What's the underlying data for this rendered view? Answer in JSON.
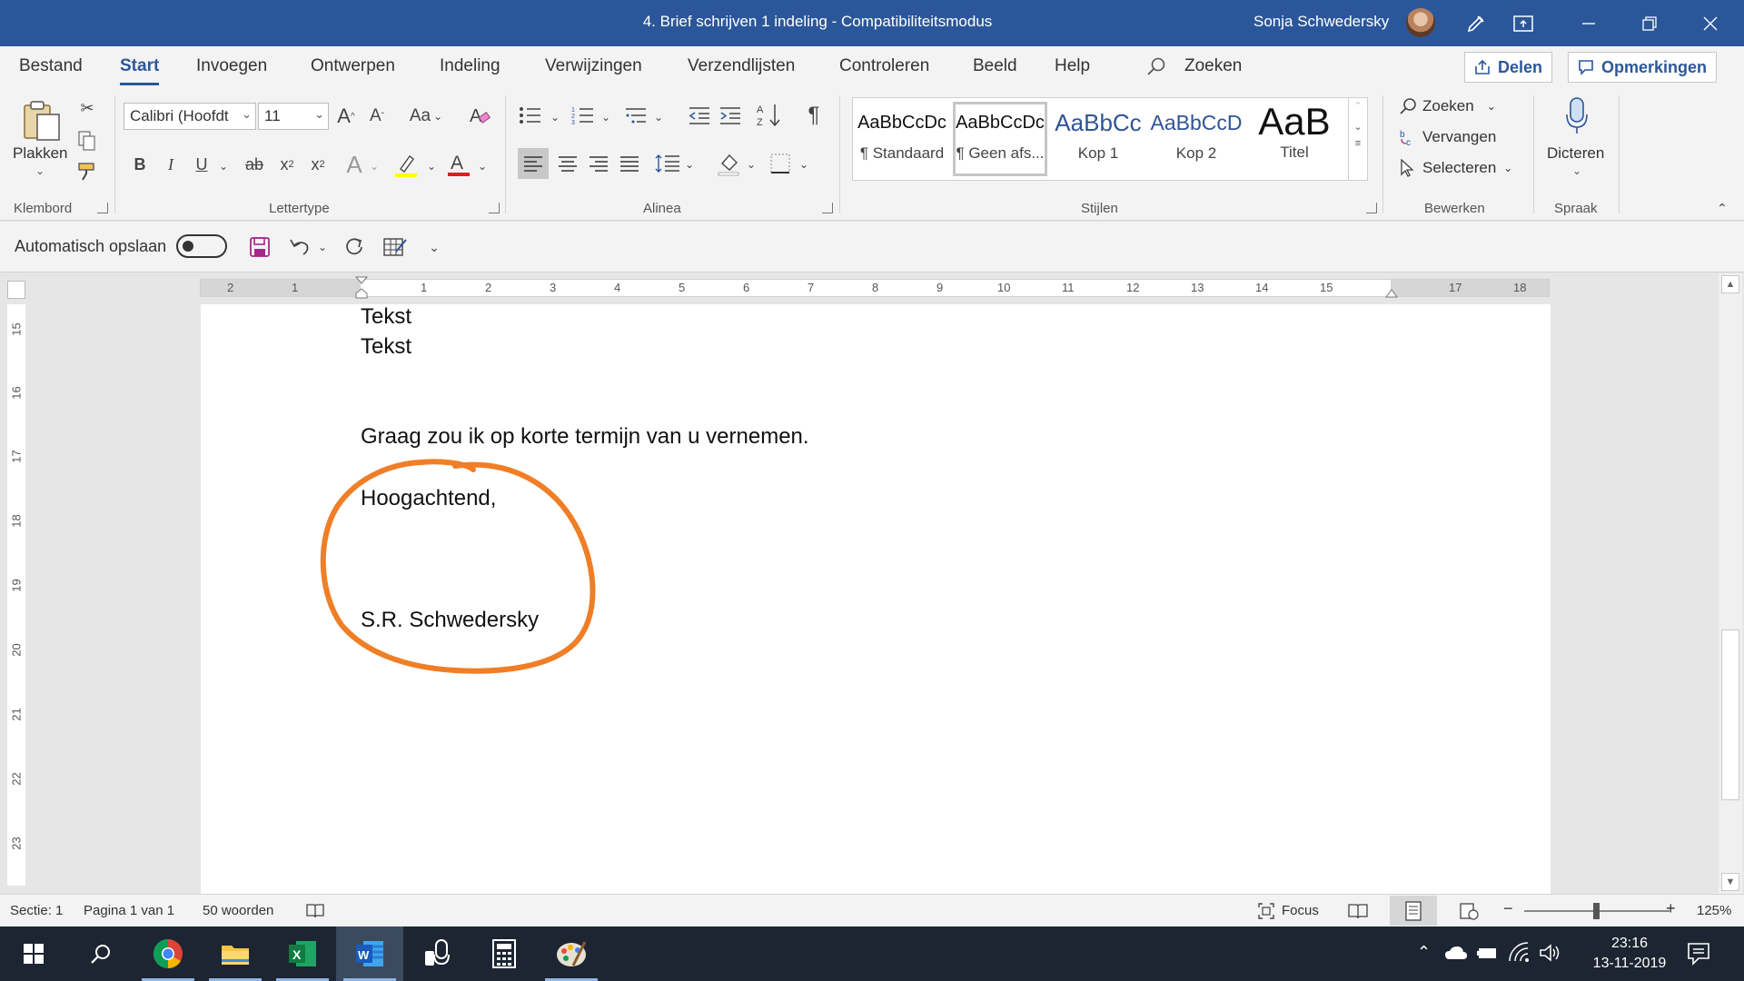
{
  "titlebar": {
    "document_title": "4. Brief schrijven 1 indeling  -  Compatibiliteitsmodus",
    "user_name": "Sonja Schwedersky",
    "icons": [
      "pen-icon",
      "ribbon-display-icon",
      "minimize-icon",
      "restore-icon",
      "close-icon"
    ]
  },
  "tabs": [
    "Bestand",
    "Start",
    "Invoegen",
    "Ontwerpen",
    "Indeling",
    "Verwijzingen",
    "Verzendlijsten",
    "Controleren",
    "Beeld",
    "Help"
  ],
  "active_tab": "Start",
  "search_label": "Zoeken",
  "share": {
    "delen": "Delen",
    "opmerkingen": "Opmerkingen"
  },
  "ribbon": {
    "clipboard": {
      "label": "Klembord",
      "paste": "Plakken"
    },
    "font": {
      "label": "Lettertype",
      "font_name": "Calibri (Hoofdt",
      "font_size": "11",
      "case_btn": "Aa"
    },
    "paragraph": {
      "label": "Alinea"
    },
    "styles": {
      "label": "Stijlen",
      "items": [
        {
          "sample": "AaBbCcDc",
          "name": "¶ Standaard"
        },
        {
          "sample": "AaBbCcDc",
          "name": "¶ Geen afs..."
        },
        {
          "sample": "AaBbCc",
          "name": "Kop 1"
        },
        {
          "sample": "AaBbCcD",
          "name": "Kop 2"
        },
        {
          "sample": "AaB",
          "name": "Titel"
        }
      ],
      "heading_color": "#2f5496"
    },
    "editing": {
      "label": "Bewerken",
      "find": "Zoeken",
      "replace": "Vervangen",
      "select": "Selecteren"
    },
    "voice": {
      "label": "Spraak",
      "dictate": "Dicteren"
    }
  },
  "qat": {
    "autosave": "Automatisch opslaan"
  },
  "ruler": {
    "h_numbers": [
      "2",
      "1",
      "1",
      "2",
      "3",
      "4",
      "5",
      "6",
      "7",
      "8",
      "9",
      "10",
      "11",
      "12",
      "13",
      "14",
      "15",
      "17",
      "18"
    ],
    "v_numbers": [
      "15",
      "16",
      "17",
      "18",
      "19",
      "20",
      "21",
      "22",
      "23"
    ]
  },
  "document": {
    "lines": [
      "Tekst",
      "Tekst"
    ],
    "closing_sentence": "Graag zou ik op korte termijn van u vernemen.",
    "salutation": "Hoogachtend,",
    "signature": "S.R. Schwedersky",
    "annotation_color": "#f07e26"
  },
  "status": {
    "section": "Sectie: 1",
    "page": "Pagina 1 van 1",
    "words": "50 woorden",
    "focus": "Focus",
    "zoom": "125%"
  },
  "taskbar": {
    "time": "23:16",
    "date": "13-11-2019",
    "apps": [
      "windows-start-icon",
      "search-icon",
      "chrome-icon",
      "file-explorer-icon",
      "excel-icon",
      "word-icon",
      "dictation-app-icon",
      "calculator-icon",
      "paint-icon"
    ]
  },
  "colors": {
    "word_blue": "#2b579a",
    "taskbar": "#1c2531"
  }
}
